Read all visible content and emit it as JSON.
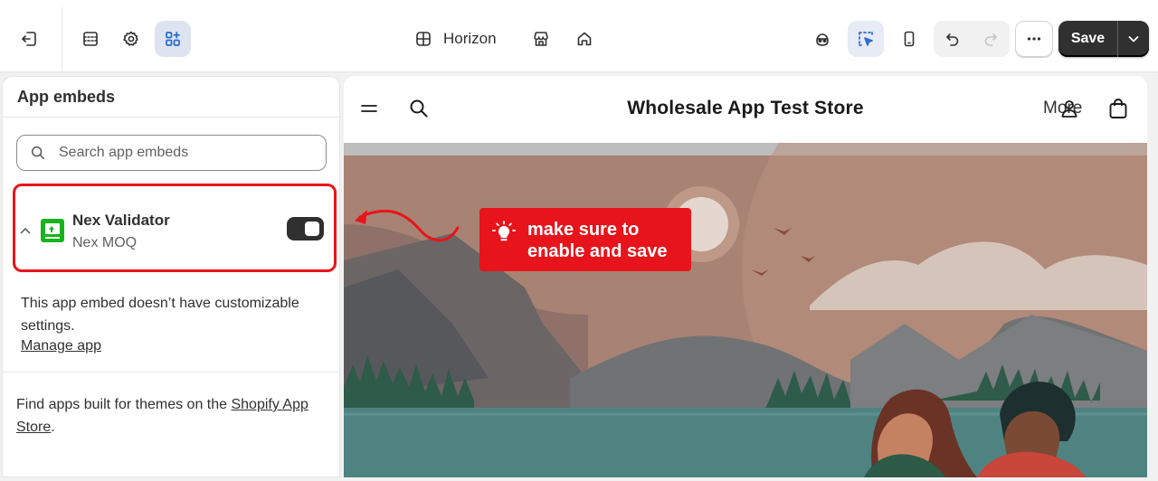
{
  "toolbar": {
    "theme_name": "Horizon",
    "save_label": "Save"
  },
  "panel": {
    "title": "App embeds",
    "search_placeholder": "Search app embeds",
    "embed": {
      "name": "Nex Validator",
      "sub": "Nex MOQ",
      "enabled": true
    },
    "note": "This app embed doesn’t have customizable settings.",
    "manage_label": "Manage app",
    "find_prefix": "Find apps built for themes on the ",
    "find_link": "Shopify App Store",
    "find_suffix": "."
  },
  "preview": {
    "store_title": "Wholesale App Test Store",
    "more_label": "More"
  },
  "callout": {
    "line1": "make sure to",
    "line2": "enable and save"
  },
  "colors": {
    "callout_red": "#e8141b",
    "toggle_dark": "#303030",
    "active_blue": "#2c6ecb"
  }
}
